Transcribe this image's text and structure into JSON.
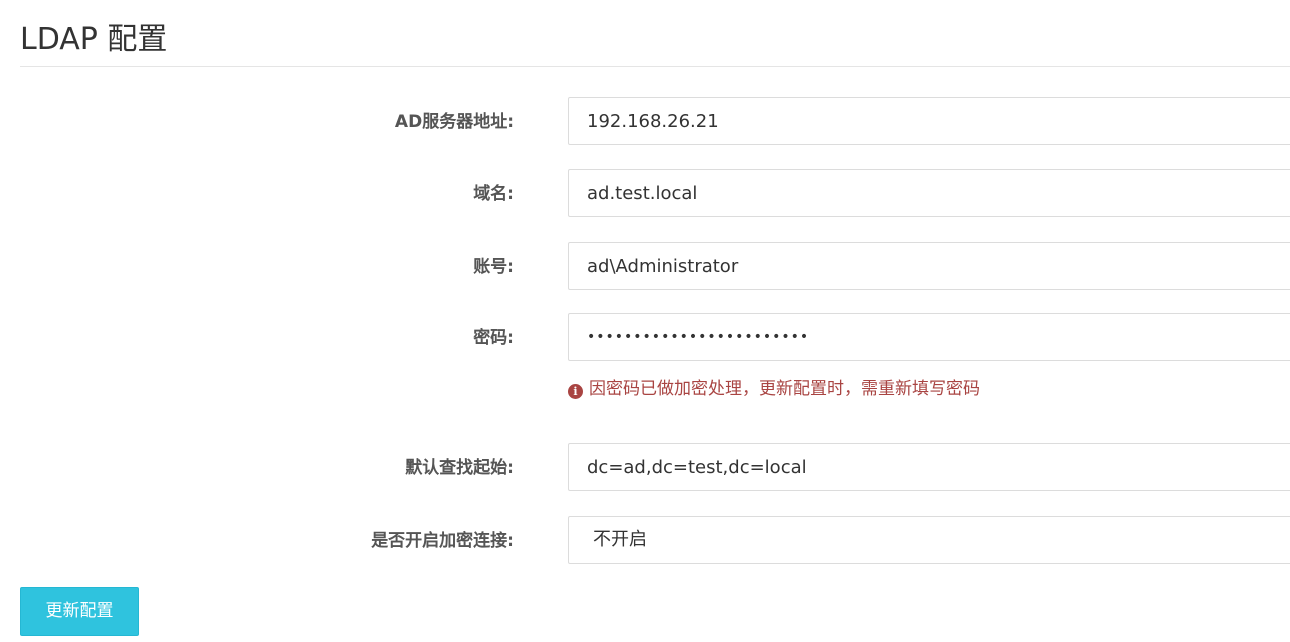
{
  "page": {
    "title": "LDAP 配置"
  },
  "form": {
    "server": {
      "label": "AD服务器地址:",
      "value": "192.168.26.21"
    },
    "domain": {
      "label": "域名:",
      "value": "ad.test.local"
    },
    "account": {
      "label": "账号:",
      "value": "ad\\Administrator"
    },
    "password": {
      "label": "密码:",
      "value": "••••••••••••••••••••••••",
      "hint": "因密码已做加密处理，更新配置时，需重新填写密码",
      "hint_icon": "info-circle-icon"
    },
    "base_dn": {
      "label": "默认查找起始:",
      "value": "dc=ad,dc=test,dc=local"
    },
    "ssl": {
      "label": "是否开启加密连接:",
      "value": "不开启"
    }
  },
  "actions": {
    "submit_label": "更新配置"
  },
  "colors": {
    "primary_button": "#2fc3de",
    "hint_text": "#a94442"
  }
}
